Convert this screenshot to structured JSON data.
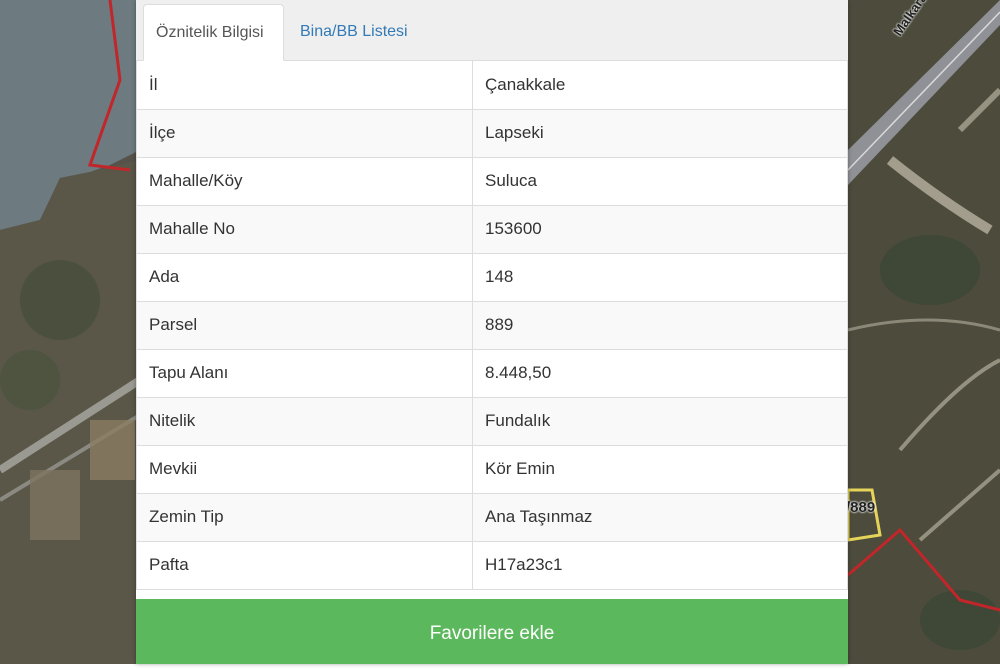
{
  "tabs": [
    {
      "label": "Öznitelik Bilgisi",
      "active": true
    },
    {
      "label": "Bina/BB Listesi",
      "active": false
    }
  ],
  "attributes": [
    {
      "key": "İl",
      "value": "Çanakkale"
    },
    {
      "key": "İlçe",
      "value": "Lapseki"
    },
    {
      "key": "Mahalle/Köy",
      "value": "Suluca"
    },
    {
      "key": "Mahalle No",
      "value": "153600"
    },
    {
      "key": "Ada",
      "value": "148"
    },
    {
      "key": "Parsel",
      "value": "889"
    },
    {
      "key": "Tapu Alanı",
      "value": "8.448,50"
    },
    {
      "key": "Nitelik",
      "value": "Fundalık"
    },
    {
      "key": "Mevkii",
      "value": "Kör Emin"
    },
    {
      "key": "Zemin Tip",
      "value": "Ana Taşınmaz"
    },
    {
      "key": "Pafta",
      "value": "H17a23c1"
    }
  ],
  "button": {
    "label": "Favorilere ekle"
  },
  "map": {
    "road_label": "Malkara-Ça",
    "parcel_label": "/889"
  },
  "colors": {
    "button_green": "#5cb85c",
    "tab_link": "#337ab7",
    "parcel_boundary": "#d32f2f",
    "selected_parcel": "#e6d45a"
  }
}
